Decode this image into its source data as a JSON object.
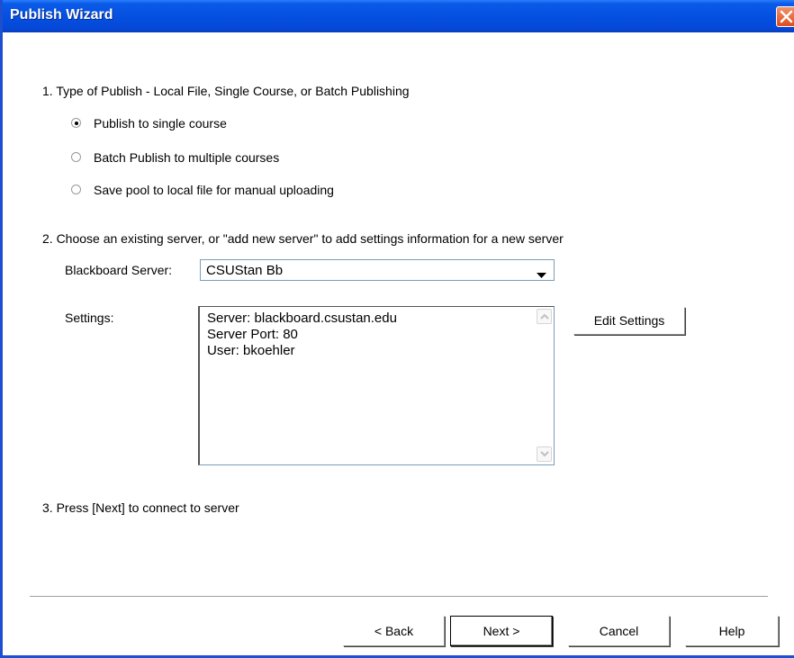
{
  "window": {
    "title": "Publish Wizard"
  },
  "step1": {
    "heading": "1.  Type of Publish - Local File, Single Course, or Batch Publishing",
    "options": [
      {
        "label": "Publish to single course",
        "checked": true
      },
      {
        "label": "Batch Publish to multiple courses",
        "checked": false
      },
      {
        "label": "Save pool to local file for manual uploading",
        "checked": false
      }
    ]
  },
  "step2": {
    "heading": "2.  Choose an existing server, or \"add new server\" to add settings information for a new server",
    "server_label": "Blackboard Server:",
    "server_value": "CSUStan Bb",
    "settings_label": "Settings:",
    "settings_lines": [
      "Server: blackboard.csustan.edu",
      "Server Port: 80",
      "User: bkoehler"
    ],
    "edit_settings_label": "Edit Settings"
  },
  "step3": {
    "heading": "3.  Press [Next] to connect to server"
  },
  "buttons": {
    "back": "< Back",
    "next": "Next >",
    "cancel": "Cancel",
    "help": "Help"
  },
  "colors": {
    "titlebar": "#0550e0",
    "close": "#df4c1d"
  }
}
